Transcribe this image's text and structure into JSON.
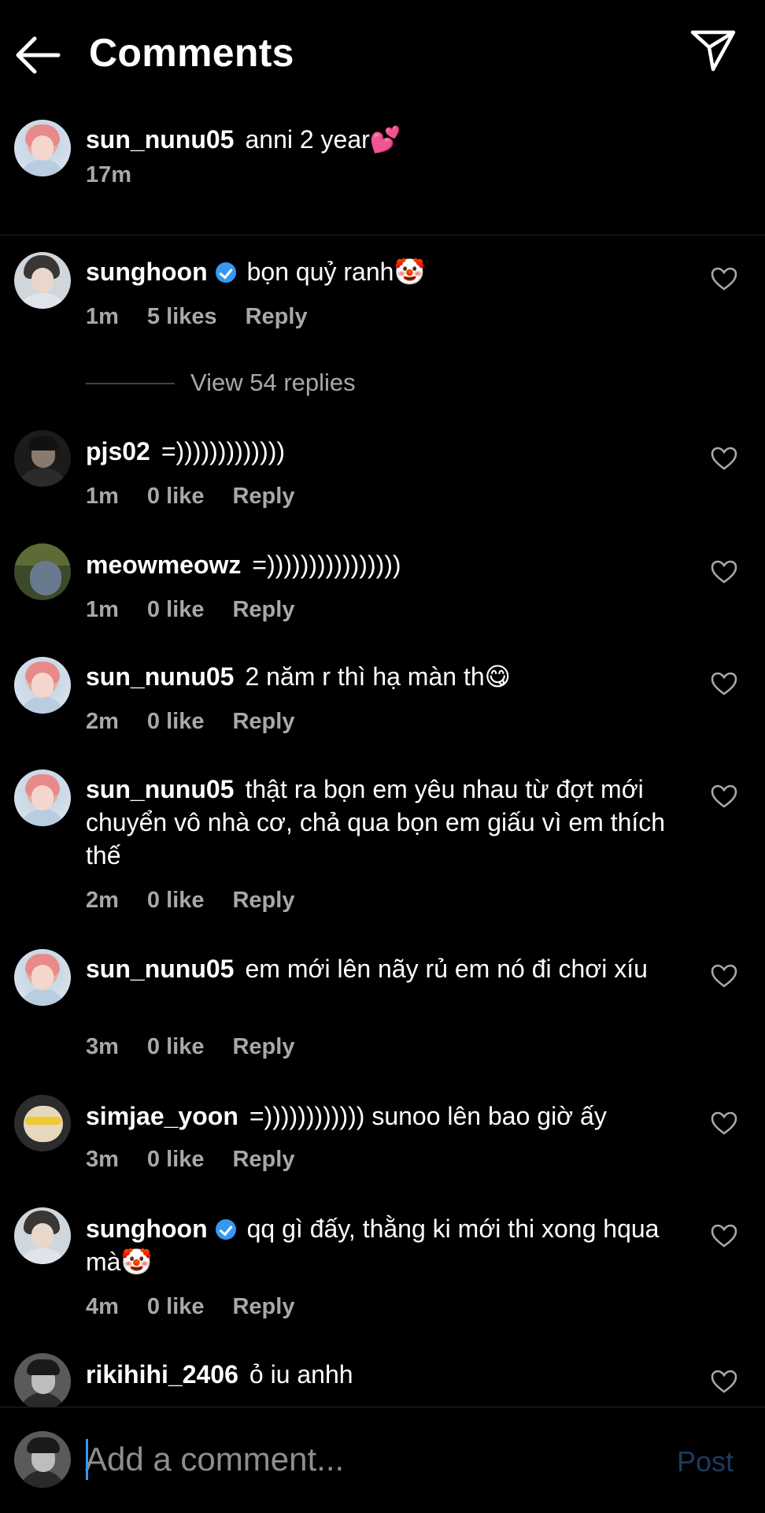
{
  "header": {
    "title": "Comments"
  },
  "caption": {
    "username": "sun_nunu05",
    "text": "anni 2 year💕",
    "time": "17m"
  },
  "comments": [
    {
      "username": "sunghoon",
      "verified": true,
      "text": "bọn quỷ ranh🤡",
      "time": "1m",
      "likes": "5 likes",
      "reply": "Reply"
    },
    {
      "username": "pjs02",
      "verified": false,
      "text": "=)))))))))))))",
      "time": "1m",
      "likes": "0 like",
      "reply": "Reply"
    },
    {
      "username": "meowmeowz",
      "verified": false,
      "text": "=))))))))))))))))",
      "time": "1m",
      "likes": "0 like",
      "reply": "Reply"
    },
    {
      "username": "sun_nunu05",
      "verified": false,
      "text": "2 năm r thì hạ màn th😋",
      "time": "2m",
      "likes": "0 like",
      "reply": "Reply"
    },
    {
      "username": "sun_nunu05",
      "verified": false,
      "text": "thật ra bọn em yêu nhau từ đợt mới chuyển vô nhà cơ, chả qua bọn em giấu vì em thích thế",
      "time": "2m",
      "likes": "0 like",
      "reply": "Reply"
    },
    {
      "username": "sun_nunu05",
      "verified": false,
      "text": "em mới lên nãy rủ em nó đi chơi xíu",
      "time": "3m",
      "likes": "0 like",
      "reply": "Reply"
    },
    {
      "username": "simjae_yoon",
      "verified": false,
      "text": "=)))))))))))) sunoo lên bao giờ ấy",
      "time": "3m",
      "likes": "0 like",
      "reply": "Reply"
    },
    {
      "username": "sunghoon",
      "verified": true,
      "text": "qq gì đấy, thằng ki mới thi xong hqua mà🤡",
      "time": "4m",
      "likes": "0 like",
      "reply": "Reply"
    },
    {
      "username": "rikihihi_2406",
      "verified": false,
      "text": "ỏ iu anhh"
    }
  ],
  "view_replies": "View 54 replies",
  "composer": {
    "placeholder": "Add a comment...",
    "post_label": "Post"
  },
  "colors": {
    "background": "#000000",
    "meta": "#a8a8a8",
    "verified": "#3897f0",
    "post_disabled": "#1d3a5f"
  }
}
